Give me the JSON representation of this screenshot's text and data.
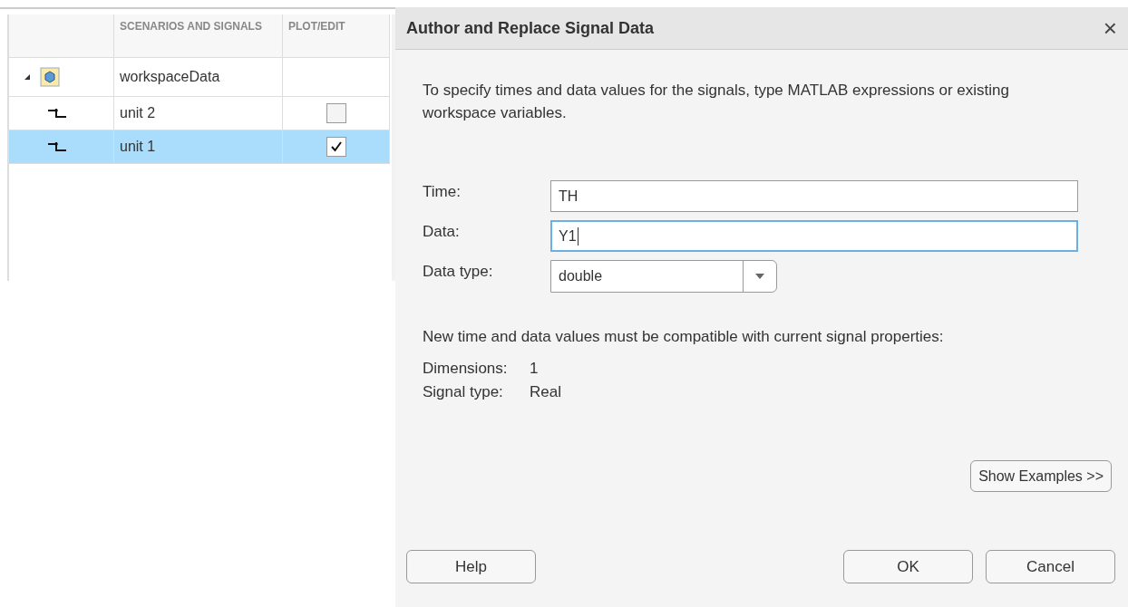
{
  "signal_table": {
    "columns": [
      {
        "label": "SCENARIOS AND SIGNALS"
      },
      {
        "label": "PLOT/EDIT"
      }
    ],
    "rows": [
      {
        "name": "workspaceData",
        "kind": "scenario",
        "expanded": true,
        "selected": false,
        "children": [
          {
            "name": "unit 2",
            "kind": "signal",
            "selected": false,
            "checked": false
          },
          {
            "name": "unit 1",
            "kind": "signal",
            "selected": true,
            "checked": true
          }
        ]
      }
    ]
  },
  "dialog": {
    "title": "Author and Replace Signal Data",
    "close": "×",
    "intro": "To specify times and data values for the signals, type MATLAB expressions or existing workspace variables.",
    "fields": [
      {
        "label": "Time:",
        "kind": "text",
        "value": "TH",
        "focused": false
      },
      {
        "label": "Data:",
        "kind": "text",
        "value": "Y1",
        "focused": true
      },
      {
        "label": "Data type:",
        "kind": "dropdown",
        "value": "double",
        "focused": false
      }
    ],
    "note": "New time and data values must be compatible with current signal properties:",
    "properties": [
      {
        "label": "Dimensions:",
        "value": "1"
      },
      {
        "label": "Signal type:",
        "value": "Real"
      }
    ],
    "show_examples": "Show Examples >>",
    "buttons": [
      {
        "label": "Help"
      },
      {
        "label": "OK"
      },
      {
        "label": "Cancel"
      }
    ]
  }
}
